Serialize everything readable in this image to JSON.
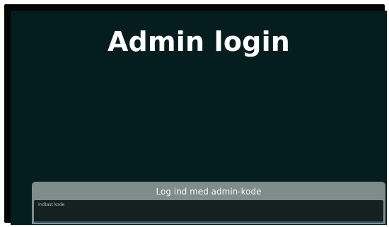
{
  "page": {
    "title": "Admin login"
  },
  "login_panel": {
    "heading": "Log ind med admin-kode",
    "code_input": {
      "placeholder": "Indtast kode",
      "value": ""
    }
  },
  "colors": {
    "background": "#041d1e",
    "frame": "#030404",
    "panel": "#7f8c8c",
    "input_background": "#14211f",
    "title_text": "#ffffff"
  }
}
